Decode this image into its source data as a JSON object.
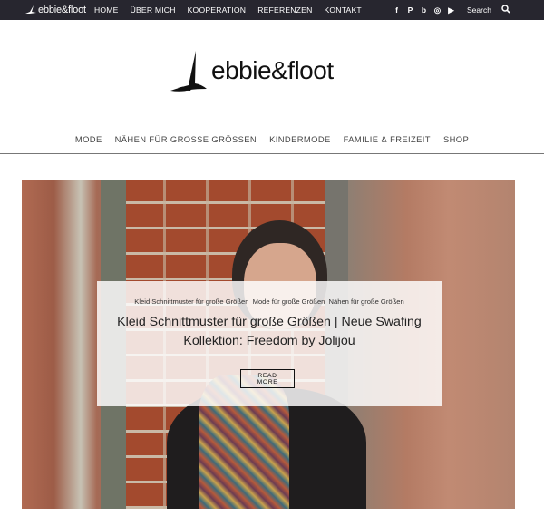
{
  "topbar": {
    "brand": "ebbie&floot",
    "nav": [
      "HOME",
      "ÜBER MICH",
      "KOOPERATION",
      "REFERENZEN",
      "KONTAKT"
    ],
    "social_icons": [
      "facebook-icon",
      "pinterest-icon",
      "bloglovin-icon",
      "instagram-icon",
      "youtube-icon"
    ],
    "social_glyphs": [
      "f",
      "P",
      "b",
      "◎",
      "▶"
    ],
    "search_label": "Search"
  },
  "logo": {
    "wordmark": "ebbie&floot"
  },
  "main_nav": [
    "MODE",
    "NÄHEN FÜR GROSSE GRÖSSEN",
    "KINDERMODE",
    "FAMILIE & FREIZEIT",
    "SHOP"
  ],
  "featured_post": {
    "categories": [
      "Kleid Schnittmuster für große Größen",
      "Mode für große Größen",
      "Nähen für große Größen"
    ],
    "title": "Kleid Schnittmuster für große Größen | Neue Swafing Kollektion: Freedom by Jolijou",
    "read_more": "READ MORE"
  },
  "colors": {
    "topbar_bg": "#27262f",
    "text_dark": "#222222"
  }
}
